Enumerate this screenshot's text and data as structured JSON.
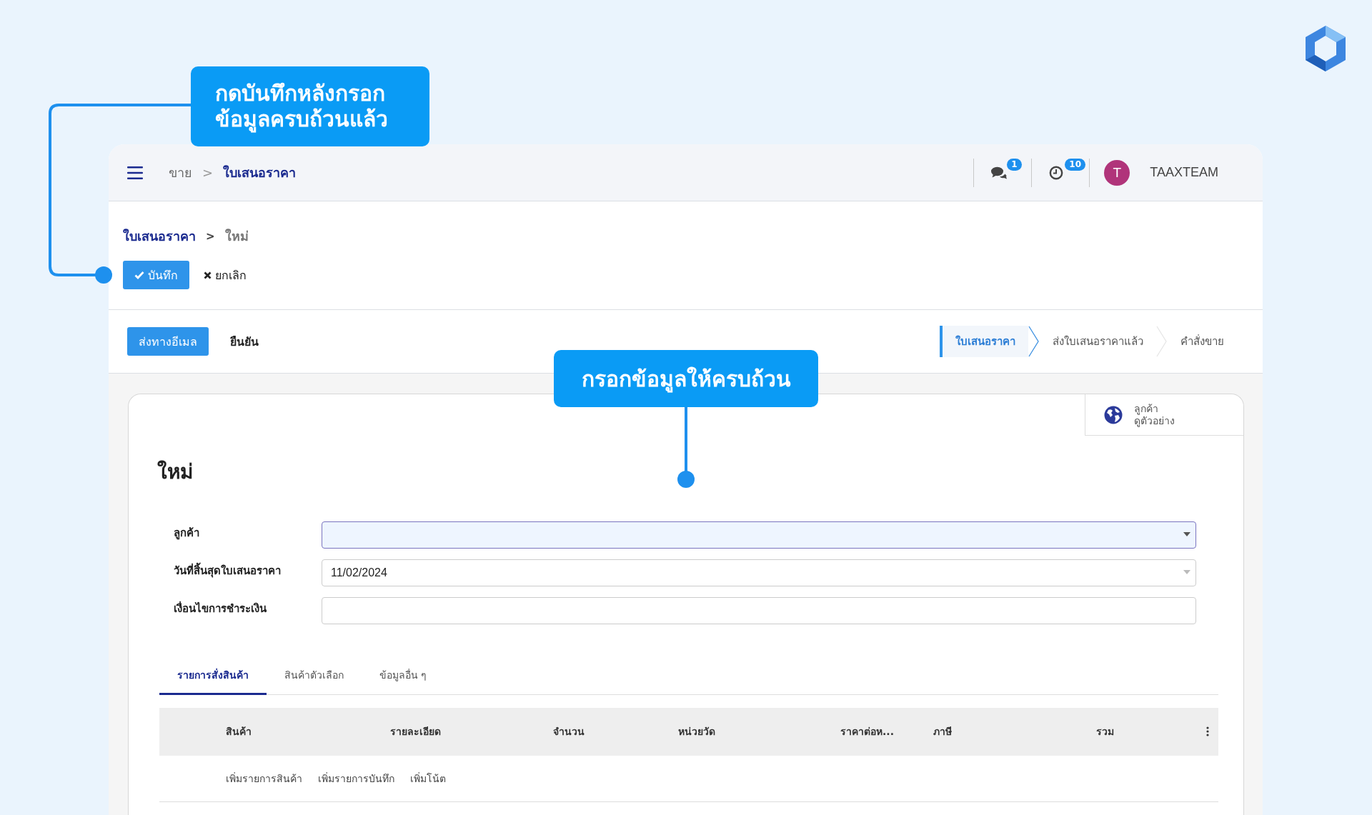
{
  "header": {
    "breadcrumb": [
      {
        "label": "ขาย",
        "current": false
      },
      {
        "label": "ใบเสนอราคา",
        "current": true
      }
    ],
    "separator": ">",
    "notifications": [
      {
        "kind": "messages",
        "badge": "1"
      },
      {
        "kind": "activities",
        "badge": "10"
      }
    ],
    "user": {
      "initial": "T",
      "name": "TAAXTEAM"
    }
  },
  "control_panel": {
    "breadcrumb_parent": "ใบเสนอราคา",
    "separator": ">",
    "breadcrumb_current": "ใหม่",
    "buttons": [
      {
        "kind": "primary",
        "label": "บันทึก"
      },
      {
        "kind": "secondary",
        "label": "ยกเลิก"
      }
    ]
  },
  "status_bar": {
    "buttons": [
      {
        "kind": "primary",
        "label": "ส่งทางอีเมล"
      },
      {
        "kind": "secondary",
        "label": "ยืนยัน"
      }
    ],
    "stages": [
      {
        "label": "ใบเสนอราคา",
        "selected": true
      },
      {
        "label": "ส่งใบเสนอราคาแล้ว",
        "selected": false
      },
      {
        "label": "คำสั่งขาย",
        "selected": false
      }
    ]
  },
  "sheet": {
    "smart_button": {
      "title": "ลูกค้า",
      "subtitle": "ดูตัวอย่าง"
    },
    "title": "ใหม่",
    "fields": [
      {
        "label": "ลูกค้า",
        "kind": "dropdown",
        "focused": true
      },
      {
        "label": "วันที่สิ้นสุดใบเสนอราคา",
        "value": "11/02/2024",
        "kind": "dropdown",
        "focused": false
      },
      {
        "label": "เงื่อนไขการชำระเงิน",
        "kind": "text",
        "focused": false
      }
    ],
    "tabs": [
      {
        "label": "รายการสั่งสินค้า",
        "selected": true
      },
      {
        "label": "สินค้าตัวเลือก",
        "selected": false
      },
      {
        "label": "ข้อมูลอื่น ๆ",
        "selected": false
      }
    ],
    "table": {
      "columns": [
        "สินค้า",
        "รายละเอียด",
        "จำนวน",
        "หน่วยวัด",
        "ราคาต่อห...",
        "ภาษี",
        "รวม"
      ],
      "add_links": [
        "เพิ่มรายการสินค้า",
        "เพิ่มรายการบันทึก",
        "เพิ่มโน้ต"
      ]
    }
  },
  "annotations": [
    {
      "kind": "elbow",
      "lines": [
        "กดบันทึกหลังกรอก",
        "ข้อมูลครบถ้วนแล้ว"
      ]
    },
    {
      "kind": "drop",
      "lines": [
        "กรอกข้อมูลให้ครบถ้วน"
      ]
    }
  ]
}
